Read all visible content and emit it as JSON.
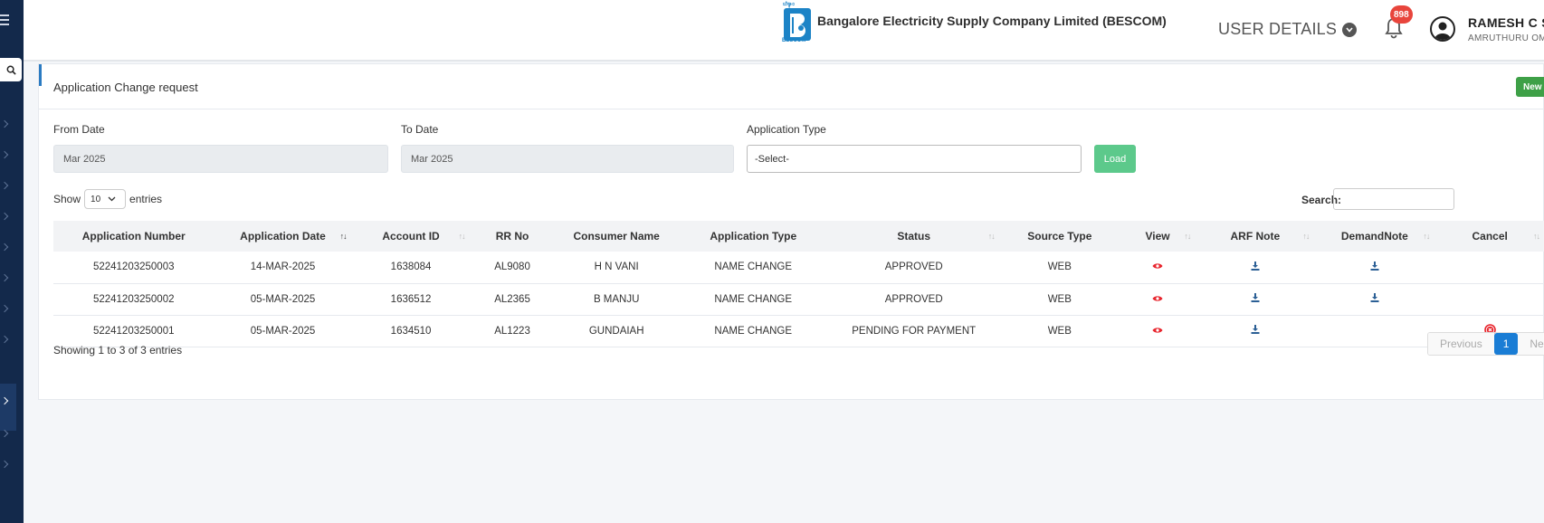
{
  "header": {
    "company": "Bangalore Electricity Supply Company Limited (BESCOM)",
    "logo_text": "BESCOM",
    "user_details": "USER DETAILS",
    "notifications": "898",
    "user_name": "RAMESH C S",
    "user_location": "AMRUTHURU OM"
  },
  "card": {
    "title": "Application Change request",
    "new_button": "New"
  },
  "filters": {
    "from_label": "From Date",
    "from_value": "Mar 2025",
    "to_label": "To Date",
    "to_value": "Mar 2025",
    "type_label": "Application Type",
    "type_value": "-Select-",
    "load_button": "Load"
  },
  "table_controls": {
    "show": "Show",
    "length": "10",
    "entries": "entries",
    "search_label": "Search:"
  },
  "table": {
    "columns": [
      "Application Number",
      "Application Date",
      "Account ID",
      "RR No",
      "Consumer Name",
      "Application Type",
      "Status",
      "Source Type",
      "View",
      "ARF Note",
      "DemandNote",
      "Cancel"
    ],
    "rows": [
      {
        "app_no": "52241203250003",
        "date": "14-MAR-2025",
        "account": "1638084",
        "rr": "AL9080",
        "name": "H N VANI",
        "type": "NAME CHANGE",
        "status": "APPROVED",
        "source": "WEB"
      },
      {
        "app_no": "52241203250002",
        "date": "05-MAR-2025",
        "account": "1636512",
        "rr": "AL2365",
        "name": "B MANJU",
        "type": "NAME CHANGE",
        "status": "APPROVED",
        "source": "WEB"
      },
      {
        "app_no": "52241203250001",
        "date": "05-MAR-2025",
        "account": "1634510",
        "rr": "AL1223",
        "name": "GUNDAIAH",
        "type": "NAME CHANGE",
        "status": "PENDING FOR PAYMENT",
        "source": "WEB"
      }
    ]
  },
  "footer": {
    "info": "Showing 1 to 3 of 3 entries",
    "previous": "Previous",
    "page": "1",
    "next": "Next"
  },
  "colors": {
    "sidebar": "#13294b",
    "load_button": "#5cc98b",
    "new_button": "#3ea047",
    "view_icon": "#e8252d",
    "download_icon": "#2b5f95",
    "page_active": "#1a7dd5"
  }
}
